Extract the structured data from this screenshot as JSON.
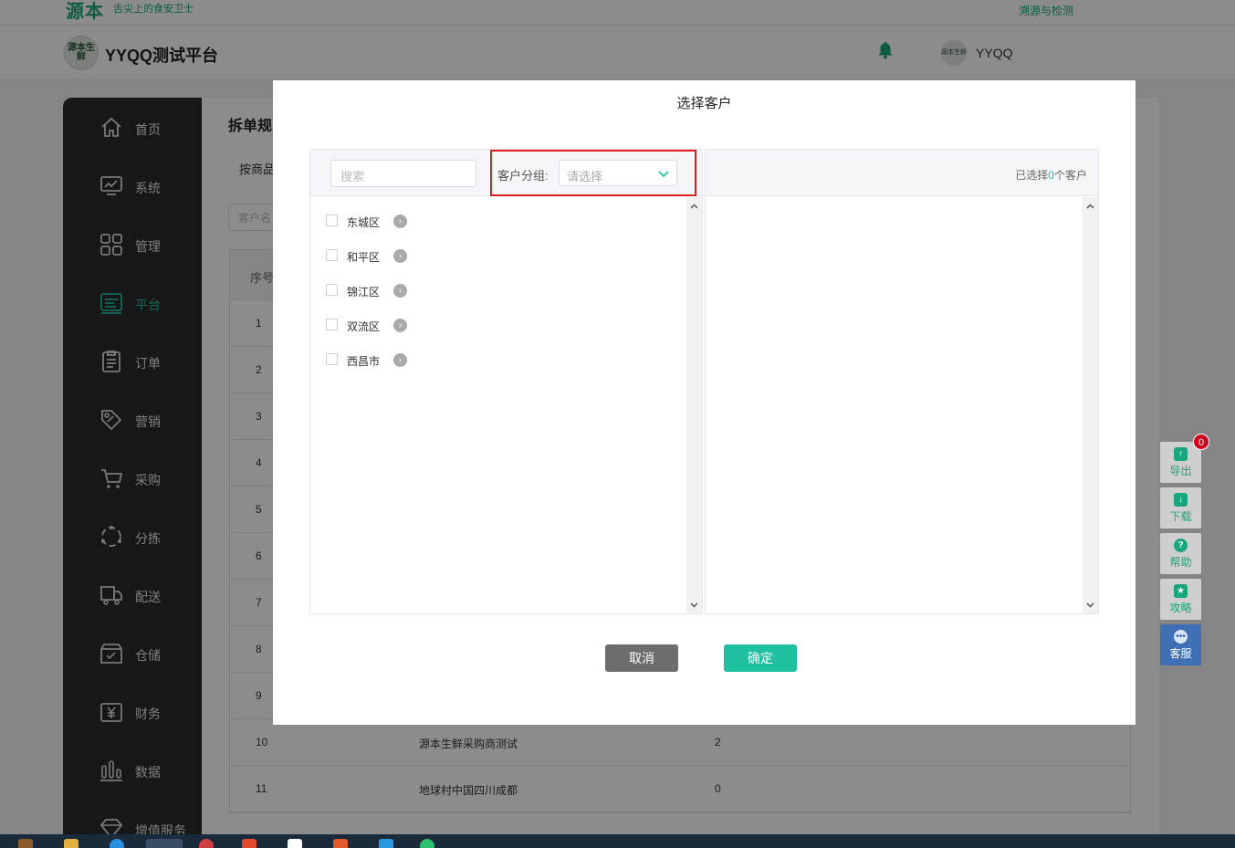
{
  "topbar": {
    "logo_text": "源本",
    "slogan": "舌尖上的食安卫士",
    "right_link": "溯源与检测"
  },
  "header": {
    "brand_avatar_text": "源本生鲜",
    "brand_title": "YYQQ测试平台",
    "user_avatar_text": "源本生鲜",
    "user_name": "YYQQ"
  },
  "sidebar": {
    "items": [
      {
        "label": "首页",
        "icon": "home-icon",
        "active": false
      },
      {
        "label": "系统",
        "icon": "monitor-icon",
        "active": false
      },
      {
        "label": "管理",
        "icon": "grid-icon",
        "active": false
      },
      {
        "label": "平台",
        "icon": "platform-icon",
        "active": true
      },
      {
        "label": "订单",
        "icon": "clipboard-icon",
        "active": false
      },
      {
        "label": "营销",
        "icon": "tag-icon",
        "active": false
      },
      {
        "label": "采购",
        "icon": "cart-icon",
        "active": false
      },
      {
        "label": "分拣",
        "icon": "sort-icon",
        "active": false
      },
      {
        "label": "配送",
        "icon": "truck-icon",
        "active": false
      },
      {
        "label": "仓储",
        "icon": "warehouse-icon",
        "active": false
      },
      {
        "label": "财务",
        "icon": "yen-icon",
        "active": false
      },
      {
        "label": "数据",
        "icon": "bar-chart-icon",
        "active": false
      },
      {
        "label": "增值服务",
        "icon": "diamond-icon",
        "active": false
      }
    ]
  },
  "content": {
    "page_title": "拆单规",
    "sub_tab": "按商品",
    "filter_placeholder": "客户名",
    "table": {
      "header_first": "序号",
      "rows": [
        {
          "no": "1",
          "name": "",
          "value": ""
        },
        {
          "no": "2",
          "name": "",
          "value": ""
        },
        {
          "no": "3",
          "name": "",
          "value": ""
        },
        {
          "no": "4",
          "name": "",
          "value": ""
        },
        {
          "no": "5",
          "name": "",
          "value": ""
        },
        {
          "no": "6",
          "name": "",
          "value": ""
        },
        {
          "no": "7",
          "name": "",
          "value": ""
        },
        {
          "no": "8",
          "name": "",
          "value": ""
        },
        {
          "no": "9",
          "name": "",
          "value": ""
        },
        {
          "no": "10",
          "name": "源本生鲜采购商测试",
          "value": "2"
        },
        {
          "no": "11",
          "name": "地球村中国四川成都",
          "value": "0"
        }
      ]
    }
  },
  "tools": {
    "export_label": "导出",
    "export_badge": "0",
    "download_label": "下载",
    "help_label": "帮助",
    "guide_label": "攻略",
    "service_label": "客服"
  },
  "modal": {
    "title": "选择客户",
    "search_placeholder": "搜索",
    "group_label": "客户分组:",
    "group_placeholder": "请选择",
    "tree_items": [
      "东城区",
      "和平区",
      "锦江区",
      "双流区",
      "西昌市"
    ],
    "selected_prefix": "已选择",
    "selected_count": "0",
    "selected_suffix": "个客户",
    "cancel_label": "取消",
    "confirm_label": "确定"
  },
  "colors": {
    "accent": "#1fc0a0",
    "sidebar_bg": "#2b2b2b",
    "highlight_border": "#e02020",
    "service_bg": "#3f6fb5"
  }
}
